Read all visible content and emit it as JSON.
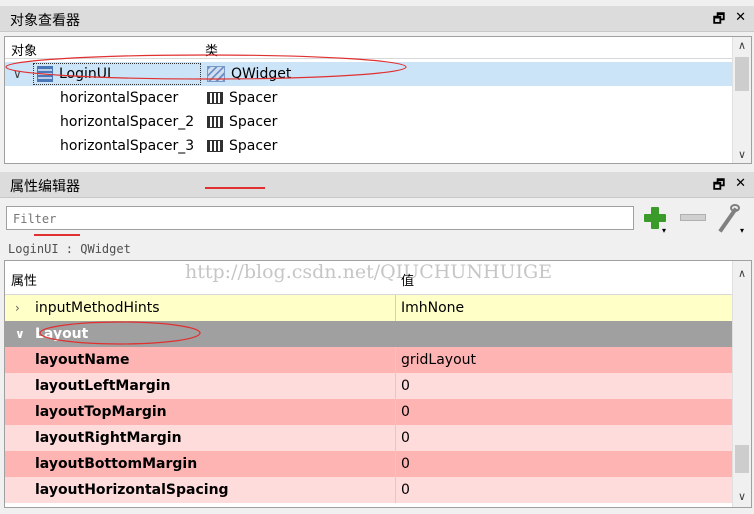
{
  "object_inspector": {
    "title": "对象查看器",
    "float_icon": "float-icon",
    "close_icon": "close-icon",
    "col_object": "对象",
    "col_class": "类",
    "rows": [
      {
        "name": "LoginUI",
        "class": "QWidget",
        "icon": "grid-layout-icon",
        "class_icon": "widget-icon",
        "selected": true
      },
      {
        "name": "horizontalSpacer",
        "class": "Spacer",
        "icon": "",
        "class_icon": "spacer-icon"
      },
      {
        "name": "horizontalSpacer_2",
        "class": "Spacer",
        "icon": "",
        "class_icon": "spacer-icon"
      },
      {
        "name": "horizontalSpacer_3",
        "class": "Spacer",
        "icon": "",
        "class_icon": "spacer-icon"
      }
    ]
  },
  "property_editor": {
    "title": "属性编辑器",
    "filter_placeholder": "Filter",
    "add_icon": "plus-icon",
    "remove_icon": "minus-icon",
    "config_icon": "wrench-icon",
    "context": "LoginUI : QWidget",
    "col_property": "属性",
    "col_value": "值",
    "watermark": "http://blog.csdn.net/QIUCHUNHUIGE",
    "rows": [
      {
        "name": "inputMethodHints",
        "value": "ImhNone"
      },
      {
        "group": "Layout"
      },
      {
        "name": "layoutName",
        "value": "gridLayout"
      },
      {
        "name": "layoutLeftMargin",
        "value": "0"
      },
      {
        "name": "layoutTopMargin",
        "value": "0"
      },
      {
        "name": "layoutRightMargin",
        "value": "0"
      },
      {
        "name": "layoutBottomMargin",
        "value": "0"
      },
      {
        "name": "layoutHorizontalSpacing",
        "value": "0"
      }
    ]
  },
  "colors": {
    "selected_row": "#cce4f7",
    "yellow_row": "#ffffc8",
    "group_row": "#a0a0a0",
    "pink_dark": "#ffb4b4",
    "pink_light": "#ffdcdc",
    "annotation_red": "#e03030"
  }
}
